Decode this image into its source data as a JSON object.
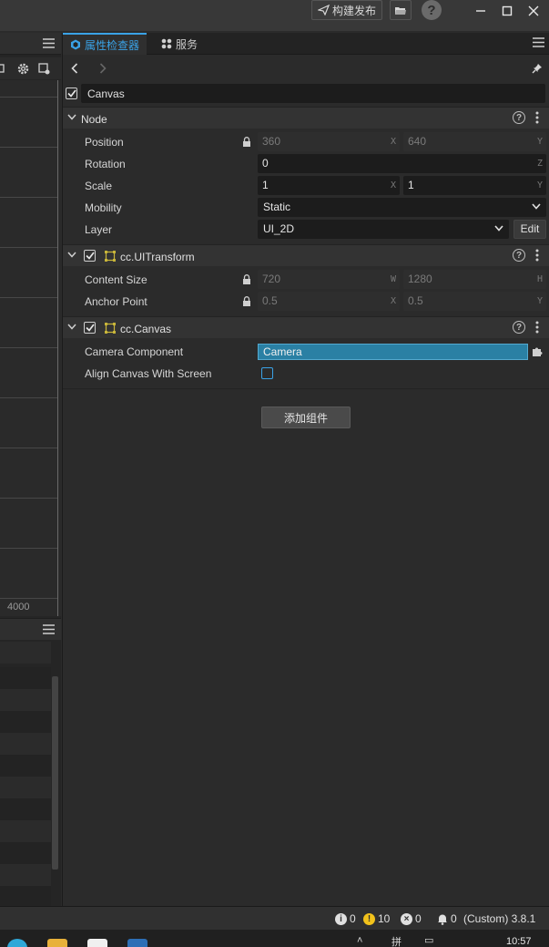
{
  "titlebar": {
    "publish_label": "构建发布",
    "icons": [
      "send-icon",
      "folder-open-icon",
      "help-icon",
      "minimize-icon",
      "maximize-icon",
      "close-icon"
    ]
  },
  "left_panel": {
    "grid_label": "4000"
  },
  "inspector": {
    "tabs": [
      {
        "label": "属性检查器",
        "icon": "inspector-icon",
        "active": true
      },
      {
        "label": "服务",
        "icon": "services-icon",
        "active": false
      }
    ],
    "node_name": "Canvas",
    "node_section": {
      "title": "Node",
      "position": {
        "label": "Position",
        "x": "360",
        "x_axis": "X",
        "y": "640",
        "y_axis": "Y"
      },
      "rotation": {
        "label": "Rotation",
        "z": "0",
        "z_axis": "Z"
      },
      "scale": {
        "label": "Scale",
        "x": "1",
        "x_axis": "X",
        "y": "1",
        "y_axis": "Y"
      },
      "mobility": {
        "label": "Mobility",
        "value": "Static"
      },
      "layer": {
        "label": "Layer",
        "value": "UI_2D",
        "edit_label": "Edit"
      }
    },
    "uitransform_section": {
      "title": "cc.UITransform",
      "content_size": {
        "label": "Content Size",
        "w": "720",
        "w_axis": "W",
        "h": "1280",
        "h_axis": "H"
      },
      "anchor_point": {
        "label": "Anchor Point",
        "x": "0.5",
        "x_axis": "X",
        "y": "0.5",
        "y_axis": "Y"
      }
    },
    "canvas_section": {
      "title": "cc.Canvas",
      "camera_component": {
        "label": "Camera Component",
        "value": "Camera"
      },
      "align_canvas": {
        "label": "Align Canvas With Screen",
        "checked": false
      }
    },
    "add_component_label": "添加组件"
  },
  "statusbar": {
    "info_count": "0",
    "warning_count": "10",
    "error_count": "0",
    "notification_count": "0",
    "version": "(Custom) 3.8.1"
  },
  "taskbar": {
    "clock": "10:57"
  },
  "colors": {
    "accent": "#3aa2e6",
    "camera_field": "#2a80a4",
    "warning": "#f2c21b",
    "component_icon": "#c8b53a"
  }
}
